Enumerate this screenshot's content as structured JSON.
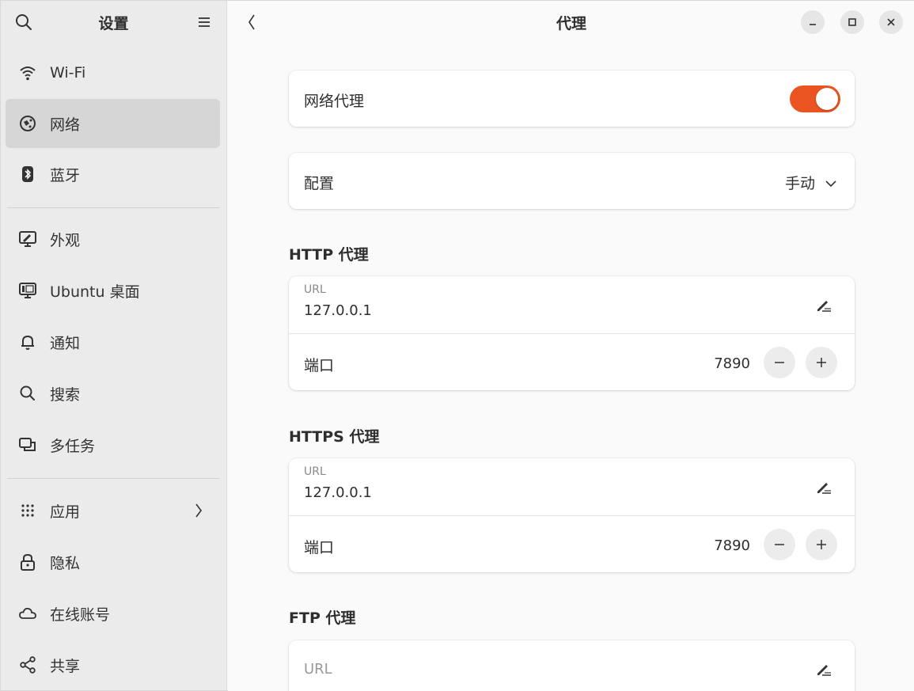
{
  "sidebar": {
    "title": "设置",
    "items": [
      {
        "label": "Wi-Fi",
        "icon": "wifi-icon"
      },
      {
        "label": "网络",
        "icon": "network-icon",
        "selected": true
      },
      {
        "label": "蓝牙",
        "icon": "bluetooth-icon"
      },
      {
        "label": "外观",
        "icon": "appearance-icon"
      },
      {
        "label": "Ubuntu 桌面",
        "icon": "desktop-icon"
      },
      {
        "label": "通知",
        "icon": "bell-icon"
      },
      {
        "label": "搜索",
        "icon": "search-icon"
      },
      {
        "label": "多任务",
        "icon": "multitask-icon"
      },
      {
        "label": "应用",
        "icon": "apps-grid-icon"
      },
      {
        "label": "隐私",
        "icon": "lock-icon"
      },
      {
        "label": "在线账号",
        "icon": "cloud-icon"
      },
      {
        "label": "共享",
        "icon": "share-icon"
      }
    ]
  },
  "header": {
    "title": "代理"
  },
  "proxy": {
    "network_proxy_label": "网络代理",
    "network_proxy_enabled": true,
    "config_label": "配置",
    "config_value": "手动",
    "http": {
      "title": "HTTP 代理",
      "url_caption": "URL",
      "url_value": "127.0.0.1",
      "port_label": "端口",
      "port_value": "7890"
    },
    "https": {
      "title": "HTTPS 代理",
      "url_caption": "URL",
      "url_value": "127.0.0.1",
      "port_label": "端口",
      "port_value": "7890"
    },
    "ftp": {
      "title": "FTP 代理",
      "url_placeholder": "URL"
    }
  },
  "colors": {
    "accent": "#e95420",
    "sidebar_bg": "#ebebeb",
    "selected_bg": "#d6d6d6",
    "content_bg": "#fafafa"
  }
}
